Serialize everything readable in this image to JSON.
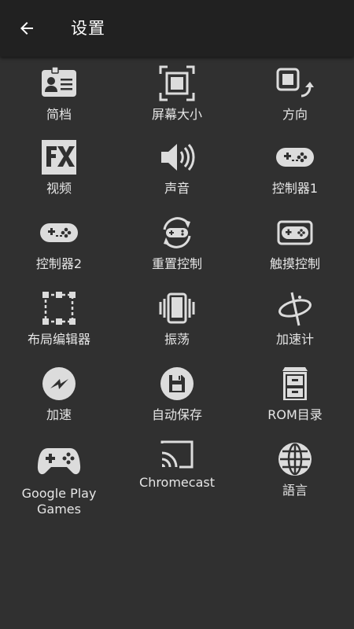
{
  "appbar": {
    "title": "设置",
    "back_icon": "arrow-back-icon"
  },
  "items": [
    {
      "id": "archive",
      "label": "简档",
      "icon": "id-card-icon"
    },
    {
      "id": "screen-size",
      "label": "屏幕大小",
      "icon": "screen-size-icon"
    },
    {
      "id": "orientation",
      "label": "方向",
      "icon": "rotate-screen-icon"
    },
    {
      "id": "video",
      "label": "视频",
      "icon": "fx-icon"
    },
    {
      "id": "sound",
      "label": "声音",
      "icon": "speaker-icon"
    },
    {
      "id": "controller1",
      "label": "控制器1",
      "icon": "gamepad-icon"
    },
    {
      "id": "controller2",
      "label": "控制器2",
      "icon": "gamepad-icon"
    },
    {
      "id": "reset-controls",
      "label": "重置控制",
      "icon": "reset-gamepad-icon"
    },
    {
      "id": "touch-controls",
      "label": "触摸控制",
      "icon": "touch-gamepad-icon"
    },
    {
      "id": "layout-editor",
      "label": "布局编辑器",
      "icon": "layout-select-icon"
    },
    {
      "id": "vibration",
      "label": "振荡",
      "icon": "vibrate-icon"
    },
    {
      "id": "accelerometer",
      "label": "加速计",
      "icon": "accelerometer-icon"
    },
    {
      "id": "speedup",
      "label": "加速",
      "icon": "lightning-icon"
    },
    {
      "id": "autosave",
      "label": "自动保存",
      "icon": "floppy-icon"
    },
    {
      "id": "rom-dir",
      "label": "ROM目录",
      "icon": "cabinet-icon"
    },
    {
      "id": "google-play",
      "label": "Google Play Games",
      "icon": "play-gamepad-icon"
    },
    {
      "id": "chromecast",
      "label": "Chromecast",
      "icon": "cast-icon"
    },
    {
      "id": "language",
      "label": "語言",
      "icon": "globe-icon"
    }
  ]
}
